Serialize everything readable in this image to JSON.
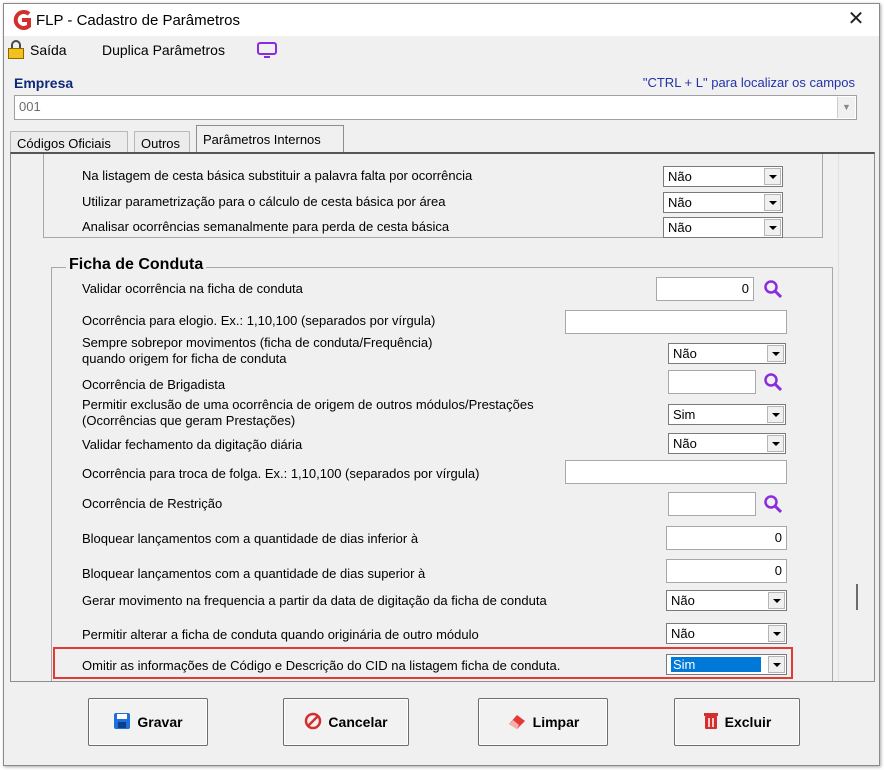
{
  "window": {
    "title": "FLP - Cadastro de Parâmetros",
    "close_glyph": "✕"
  },
  "toolbar": {
    "exit_label": "Saída",
    "duplicate_label": "Duplica Parâmetros"
  },
  "empresa": {
    "label": "Empresa",
    "hint": "\"CTRL + L\" para localizar os campos",
    "value": "001"
  },
  "tabs": [
    {
      "label": "Códigos Oficiais",
      "active": false
    },
    {
      "label": "Outros",
      "active": false
    },
    {
      "label": "Parâmetros Internos",
      "active": true
    }
  ],
  "cesta": {
    "rows": [
      {
        "label": "Na listagem de cesta básica substituir a palavra falta por ocorrência",
        "value": "Não"
      },
      {
        "label": "Utilizar parametrização para o cálculo de cesta básica por área",
        "value": "Não"
      },
      {
        "label": "Analisar ocorrências semanalmente para  perda de cesta básica",
        "value": "Não"
      }
    ]
  },
  "ficha": {
    "title": "Ficha de Conduta",
    "validar_ocorrencia": {
      "label": "Validar ocorrência na ficha de conduta",
      "value": "0"
    },
    "ocorrencia_elogio": {
      "label": "Ocorrência para elogio. Ex.: 1,10,100 (separados por vírgula)",
      "value": ""
    },
    "sempre_sobrepor": {
      "label_line1": "Sempre sobrepor movimentos (ficha de conduta/Frequência)",
      "label_line2": "quando origem for ficha de conduta",
      "value": "Não"
    },
    "ocorrencia_brigadista": {
      "label": "Ocorrência de Brigadista",
      "value": ""
    },
    "permitir_exclusao": {
      "label_line1": "Permitir  exclusão de uma ocorrência de origem de outros módulos/Prestações",
      "label_line2": "(Ocorrências que geram Prestações)",
      "value": "Sim"
    },
    "validar_fechamento": {
      "label": "Validar fechamento da digitação diária",
      "value": "Não"
    },
    "ocorrencia_folga": {
      "label": "Ocorrência para troca de folga. Ex.: 1,10,100 (separados por vírgula)",
      "value": ""
    },
    "ocorrencia_restricao": {
      "label": "Ocorrência de Restrição",
      "value": ""
    },
    "bloquear_inferior": {
      "label": "Bloquear lançamentos com a quantidade de dias inferior à",
      "value": "0"
    },
    "bloquear_superior": {
      "label": "Bloquear lançamentos com a quantidade de dias superior à",
      "value": "0"
    },
    "gerar_movimento": {
      "label": "Gerar movimento na frequencia a partir da data de digitação da ficha de conduta",
      "value": "Não"
    },
    "permitir_alterar": {
      "label": "Permitir alterar a ficha de conduta quando originária de outro módulo",
      "value": "Não"
    },
    "omitir_cid": {
      "label": "Omitir as informações de Código e Descrição do CID na listagem ficha de conduta.",
      "value": "Sim"
    }
  },
  "buttons": {
    "save": "Gravar",
    "cancel": "Cancelar",
    "clear": "Limpar",
    "delete": "Excluir"
  },
  "colors": {
    "accent": "#0078d7",
    "highlight": "#e53935",
    "search_icon": "#8a2be2",
    "app_icon": "#d32f2f"
  }
}
